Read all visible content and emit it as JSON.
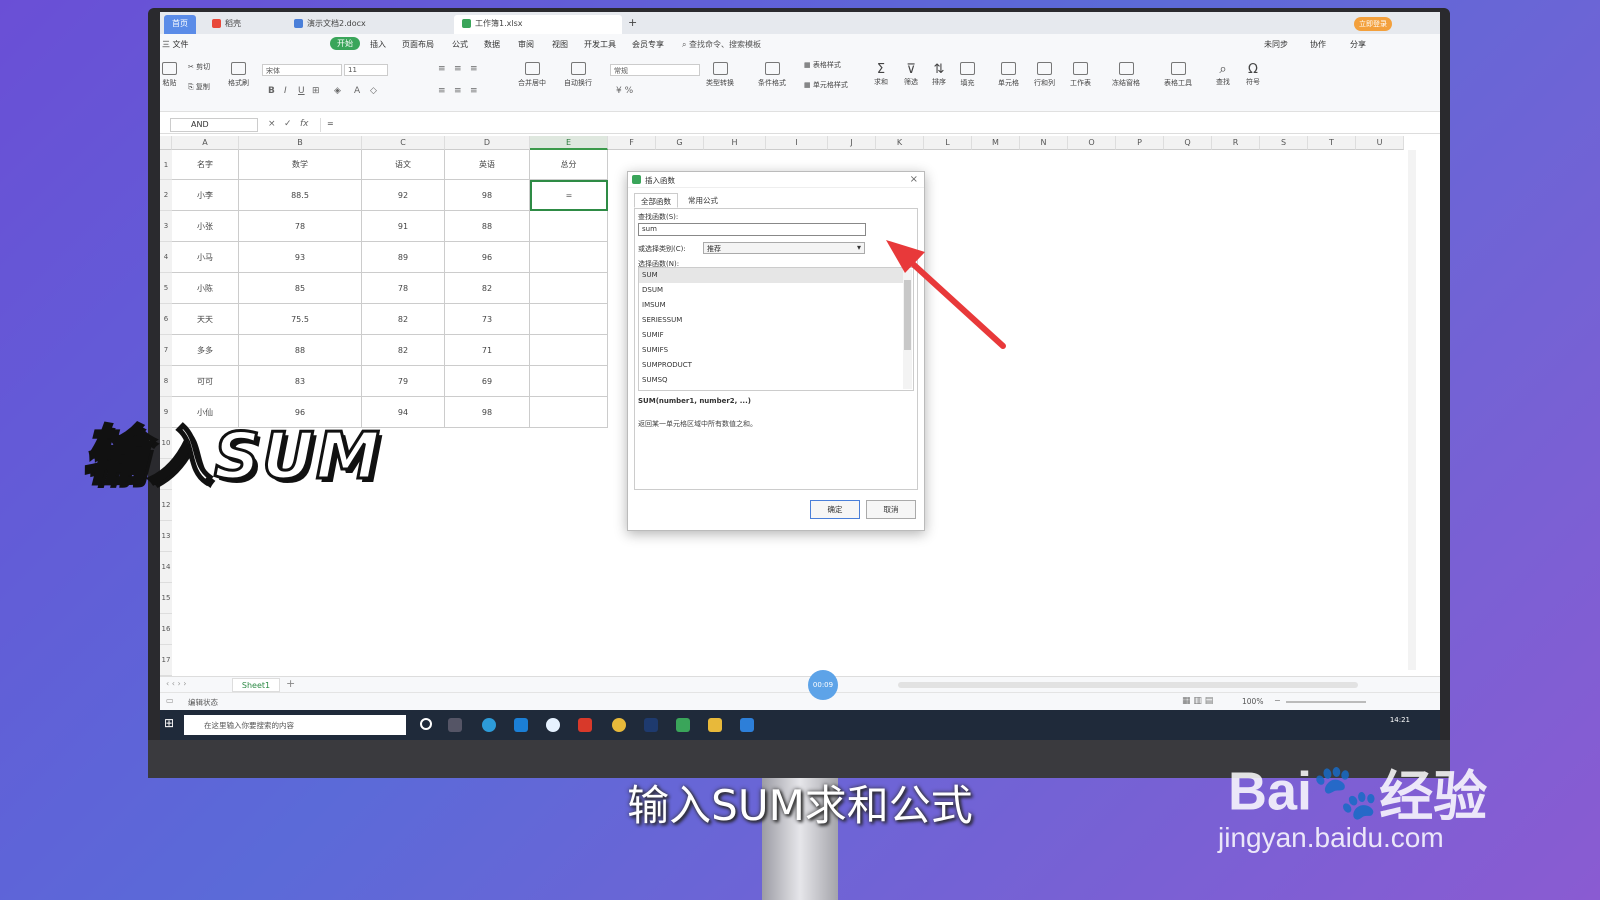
{
  "titlebar": {
    "tabs": [
      {
        "label": "首页"
      },
      {
        "label": "稻壳"
      },
      {
        "label": "演示文档2.docx"
      },
      {
        "label": "工作簿1.xlsx"
      }
    ],
    "sync": "未同步",
    "vip": "立即登录"
  },
  "menu": {
    "file": "三 文件",
    "items": [
      "开始",
      "插入",
      "页面布局",
      "公式",
      "数据",
      "审阅",
      "视图",
      "开发工具",
      "会员专享"
    ],
    "search": "查找命令、搜索模板",
    "right": [
      "未同步",
      "协作",
      "分享"
    ]
  },
  "ribbon": {
    "paste": "粘贴",
    "cut": "剪切",
    "copy": "复制",
    "format_painter": "格式刷",
    "font": "宋体",
    "size": "11",
    "number_format": "常规",
    "buttons": [
      "合并居中",
      "自动换行",
      "类型转换",
      "条件格式",
      "表格样式",
      "单元格样式",
      "求和",
      "筛选",
      "排序",
      "填充",
      "单元格",
      "行和列",
      "工作表",
      "冻结窗格",
      "表格工具",
      "查找",
      "符号"
    ]
  },
  "formula_bar": {
    "name_box": "AND",
    "cancel": "×",
    "confirm": "✓",
    "fx": "fx",
    "content": "="
  },
  "sheet": {
    "columns": [
      "A",
      "B",
      "C",
      "D",
      "E",
      "F",
      "G",
      "H",
      "I",
      "J",
      "K",
      "L",
      "M",
      "N",
      "O",
      "P",
      "Q",
      "R",
      "S",
      "T",
      "U"
    ],
    "row_numbers": [
      "1",
      "2",
      "3",
      "4",
      "5",
      "6",
      "7",
      "8",
      "9",
      "10",
      "11",
      "12",
      "13",
      "14",
      "15",
      "16",
      "17"
    ],
    "headers": [
      "名字",
      "数学",
      "语文",
      "英语",
      "总分"
    ],
    "rows": [
      [
        "小李",
        "88.5",
        "92",
        "98",
        "="
      ],
      [
        "小张",
        "78",
        "91",
        "88",
        ""
      ],
      [
        "小马",
        "93",
        "89",
        "96",
        ""
      ],
      [
        "小陈",
        "85",
        "78",
        "82",
        ""
      ],
      [
        "天天",
        "75.5",
        "82",
        "73",
        ""
      ],
      [
        "多多",
        "88",
        "82",
        "71",
        ""
      ],
      [
        "可可",
        "83",
        "79",
        "69",
        ""
      ],
      [
        "小仙",
        "96",
        "94",
        "98",
        ""
      ]
    ]
  },
  "dialog": {
    "title": "插入函数",
    "tabs": [
      "全部函数",
      "常用公式"
    ],
    "search_label": "查找函数(S):",
    "search_value": "sum",
    "category_label": "或选择类别(C):",
    "category_value": "推荐",
    "list_label": "选择函数(N):",
    "functions": [
      "SUM",
      "DSUM",
      "IMSUM",
      "SERIESSUM",
      "SUMIF",
      "SUMIFS",
      "SUMPRODUCT",
      "SUMSQ"
    ],
    "signature": "SUM(number1, number2, ...)",
    "description": "返回某一单元格区域中所有数值之和。",
    "ok": "确定",
    "cancel": "取消"
  },
  "sheet_tab": "Sheet1",
  "add_sheet": "+",
  "status": {
    "mode": "编辑状态",
    "zoom": "100%",
    "timer": "00:09"
  },
  "taskbar": {
    "search_placeholder": "在这里输入你要搜索的内容",
    "time": "14:21"
  },
  "overlay": {
    "big_text": "输入SUM",
    "caption": "输入SUM求和公式"
  },
  "watermark": {
    "brand": "Bai",
    "brand2": "经验",
    "url": "jingyan.baidu.com"
  },
  "colors": {
    "accent_green": "#3aa55a",
    "arrow_red": "#e8393a",
    "dialog_primary": "#4a7fd9"
  }
}
